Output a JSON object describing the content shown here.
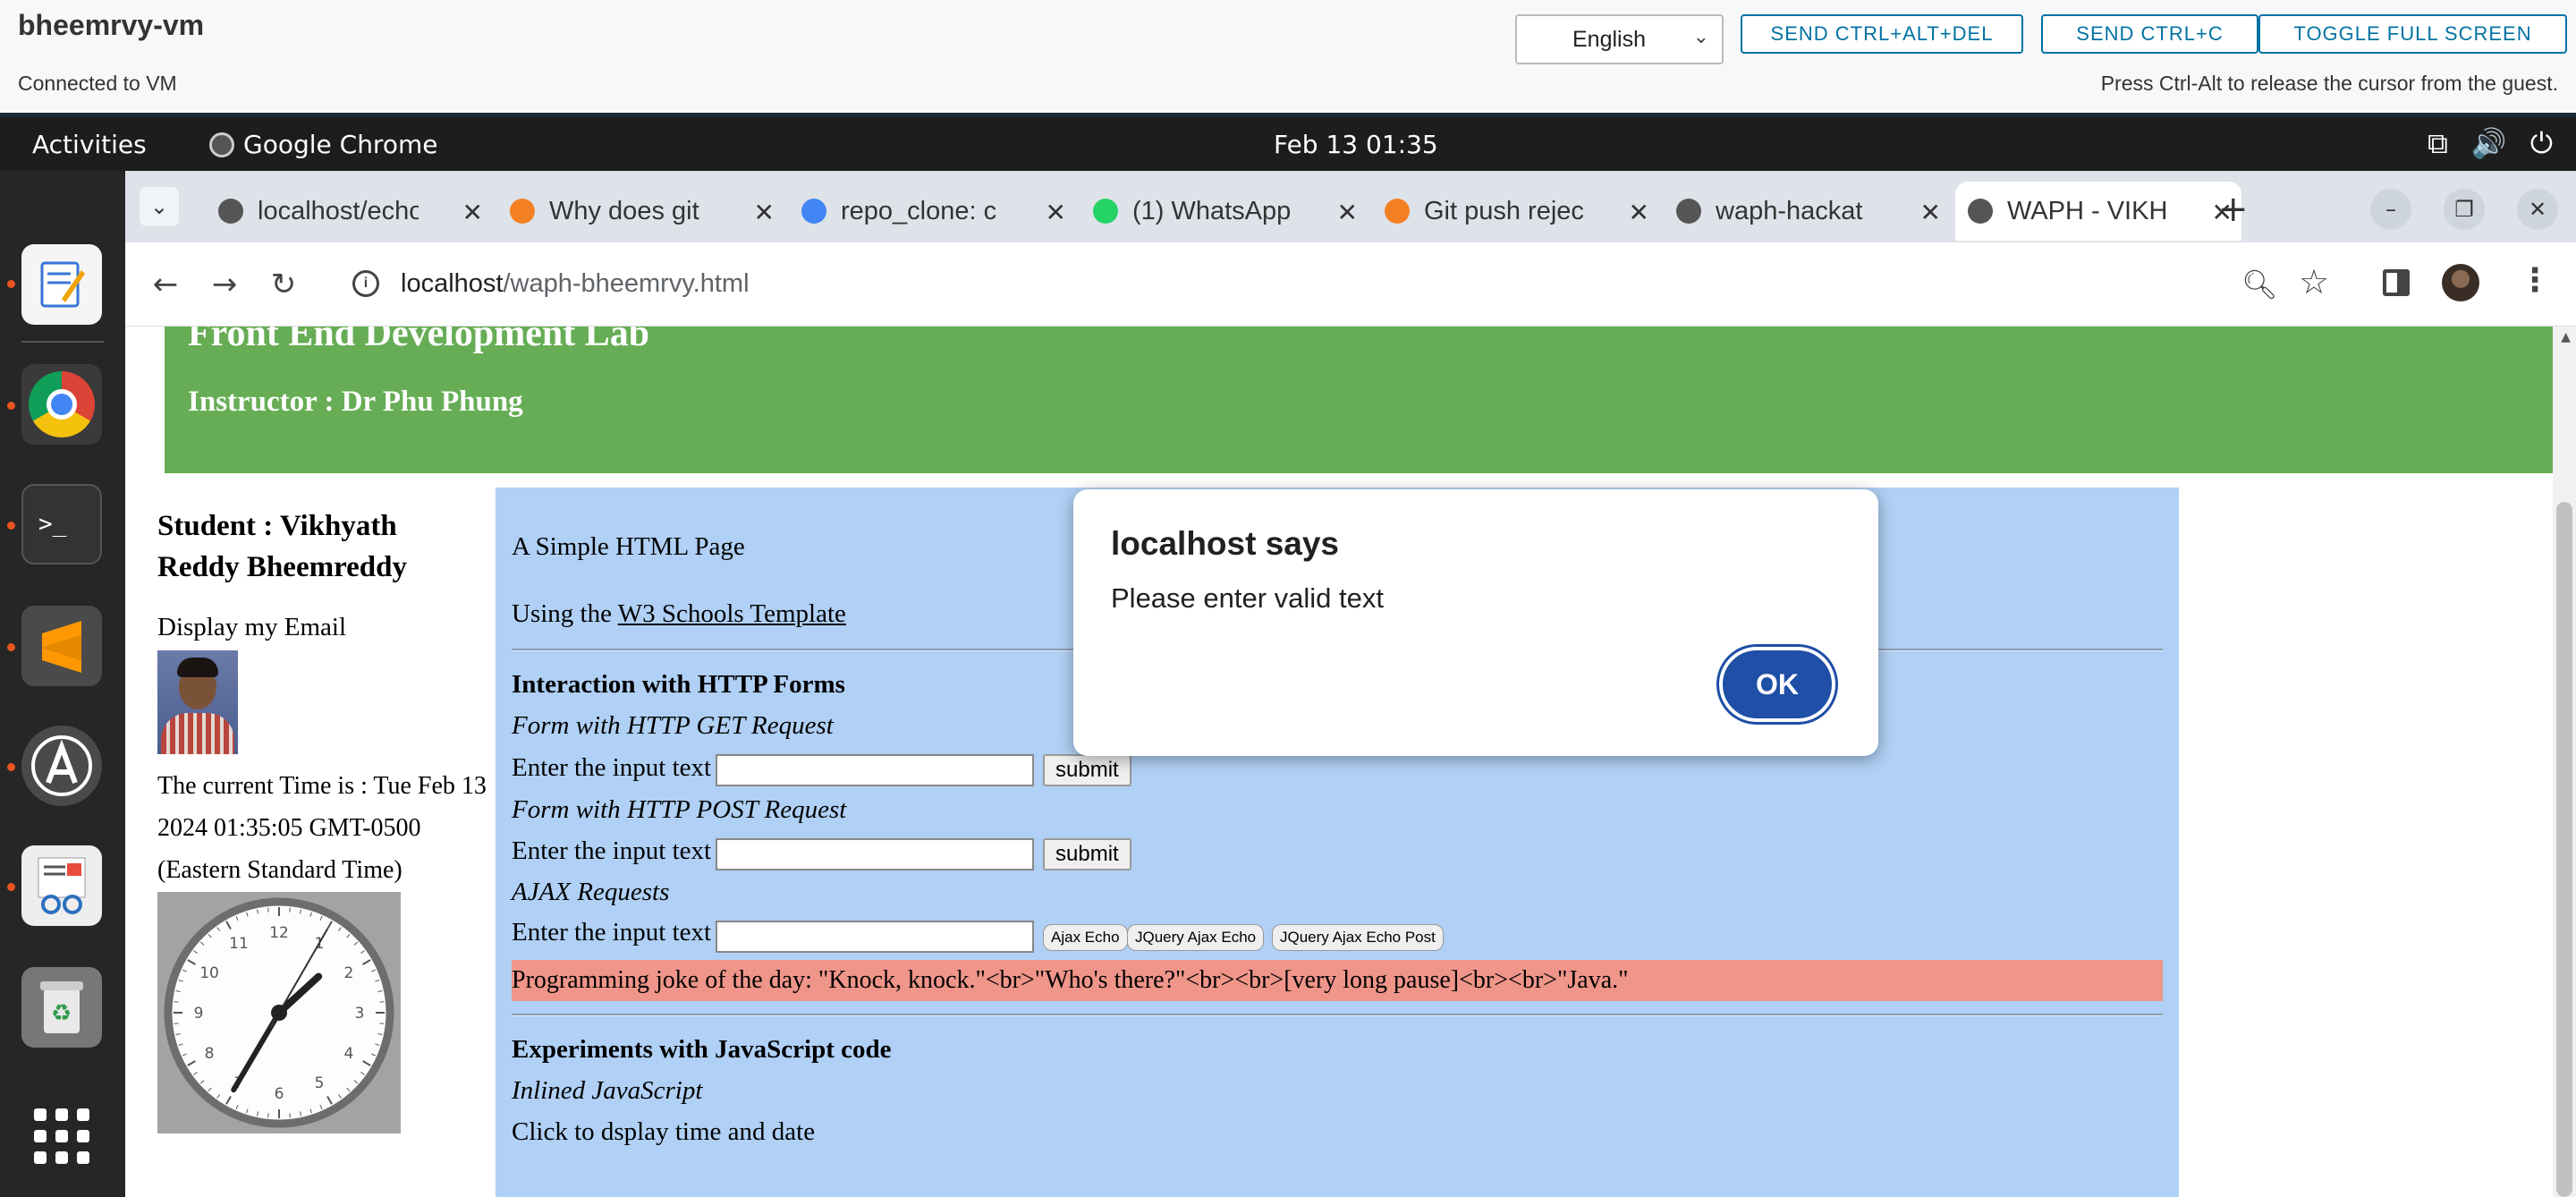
{
  "vm": {
    "title": "bheemrvy-vm",
    "status": "Connected to VM",
    "hint": "Press Ctrl-Alt to release the cursor from the guest.",
    "language": "English",
    "buttons": {
      "ctrl_alt_del": "SEND CTRL+ALT+DEL",
      "ctrl_c": "SEND CTRL+C",
      "fullscreen": "TOGGLE FULL SCREEN"
    }
  },
  "topbar": {
    "activities": "Activities",
    "app_name": "Google Chrome",
    "clock": "Feb 13  01:35"
  },
  "browser": {
    "tabs": [
      {
        "title": "localhost/echo",
        "favicon": "globe-icon"
      },
      {
        "title": "Why does git",
        "favicon": "stackoverflow-icon"
      },
      {
        "title": "repo_clone: c",
        "favicon": "google-icon"
      },
      {
        "title": "(1) WhatsApp",
        "favicon": "whatsapp-icon"
      },
      {
        "title": "Git push rejec",
        "favicon": "stackoverflow-icon"
      },
      {
        "title": "waph-hackat",
        "favicon": "globe-icon"
      },
      {
        "title": "WAPH - VIKH",
        "favicon": "globe-icon"
      }
    ],
    "url_host": "localhost",
    "url_path": "/waph-bheemrvy.html"
  },
  "page": {
    "hero_title": "Front End Development Lab",
    "instructor": "Instructor : Dr Phu Phung",
    "student_name": "Student : Vikhyath Reddy Bheemreddy",
    "email_link": "Display my Email",
    "time_text": "The current Time is : Tue Feb 13 2024 01:35:05 GMT-0500 (Eastern Standard Time)",
    "clock_numbers": [
      "12",
      "1",
      "2",
      "3",
      "4",
      "5",
      "6",
      "7",
      "8",
      "9",
      "10",
      "11"
    ],
    "main": {
      "intro": "A Simple HTML Page",
      "using_prefix": "Using the ",
      "w3_link": "W3 Schools Template",
      "forms_heading": "Interaction with HTTP Forms",
      "get_heading": "Form with HTTP GET Request",
      "post_heading": "Form with HTTP POST Request",
      "ajax_heading": "AJAX Requests",
      "input_label": "Enter the input text",
      "submit_label": "submit",
      "ajax_echo": "Ajax Echo",
      "jquery_ajax_echo": "JQuery Ajax Echo",
      "jquery_ajax_echo_post": "JQuery Ajax Echo Post",
      "joke": "Programming joke of the day: \"Knock, knock.\"<br>\"Who's there?\"<br><br>[very long pause]<br><br>\"Java.\"",
      "js_heading": "Experiments with JavaScript code",
      "inline_js": "Inlined JavaScript",
      "click_text": "Click to dsplay time and date"
    }
  },
  "alert": {
    "title": "localhost says",
    "message": "Please enter valid text",
    "ok": "OK"
  },
  "colors": {
    "hero": "#66ad55",
    "main_card": "#b0d0f5",
    "joke_bar": "#ef958a",
    "ok_button": "#1f4fa6"
  }
}
